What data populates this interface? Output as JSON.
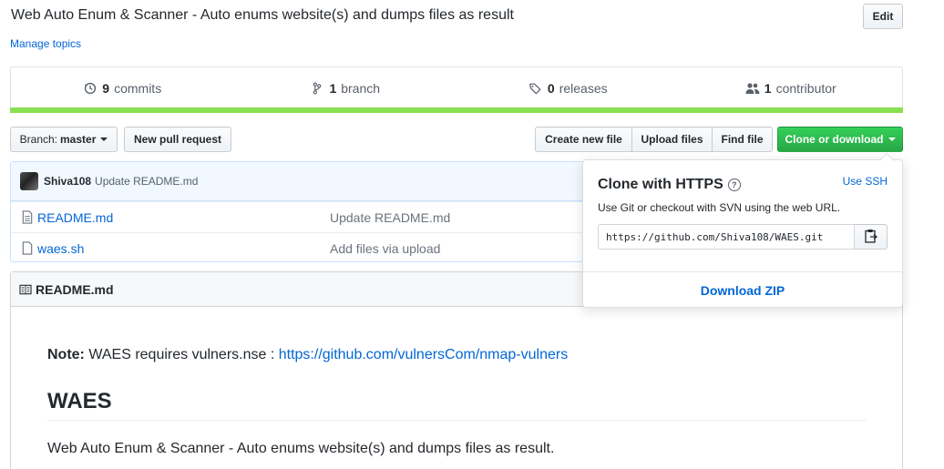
{
  "repo": {
    "description": "Web Auto Enum & Scanner - Auto enums website(s) and dumps files as result",
    "edit_label": "Edit",
    "manage_topics": "Manage topics"
  },
  "numbers": {
    "commits_count": "9",
    "commits_label": "commits",
    "branches_count": "1",
    "branches_label": "branch",
    "releases_count": "0",
    "releases_label": "releases",
    "contributors_count": "1",
    "contributors_label": "contributor",
    "language_color": "#89e051"
  },
  "toolbar": {
    "branch_prefix": "Branch:",
    "branch_name": "master",
    "new_pr": "New pull request",
    "create_file": "Create new file",
    "upload_files": "Upload files",
    "find_file": "Find file",
    "clone_download": "Clone or download",
    "clone_color": "#28a745"
  },
  "commit": {
    "author": "Shiva108",
    "message": "Update README.md"
  },
  "files": [
    {
      "name": "README.md",
      "message": "Update README.md",
      "icon": "file-icon"
    },
    {
      "name": "waes.sh",
      "message": "Add files via upload",
      "icon": "file-icon"
    }
  ],
  "readme": {
    "header": "README.md",
    "note_label": "Note:",
    "note_text": "WAES requires vulners.nse :",
    "note_link": "https://github.com/vulnersCom/nmap-vulners",
    "heading": "WAES",
    "paragraph": "Web Auto Enum & Scanner - Auto enums website(s) and dumps files as result."
  },
  "clone_dropdown": {
    "title": "Clone with HTTPS",
    "help_glyph": "?",
    "use_ssh": "Use SSH",
    "description": "Use Git or checkout with SVN using the web URL.",
    "url": "https://github.com/Shiva108/WAES.git",
    "download_zip": "Download ZIP"
  }
}
